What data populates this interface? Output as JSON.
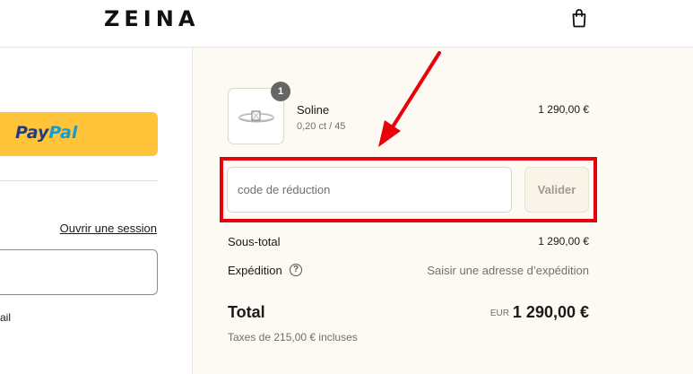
{
  "header": {
    "logo": "ZEINA",
    "cart_icon": "shopping-bag-icon"
  },
  "express_checkout": {
    "paypal_pay": "Pay",
    "paypal_pal": "Pal"
  },
  "contact": {
    "login_link": "Ouvrir une session",
    "email_value": "",
    "partial_label": "ail"
  },
  "order_summary": {
    "item": {
      "quantity": "1",
      "name": "Soline",
      "variant": "0,20 ct / 45",
      "price": "1 290,00 €",
      "image": "ring-icon"
    },
    "discount": {
      "placeholder": "code de réduction",
      "value": "",
      "apply_label": "Valider"
    },
    "subtotal_label": "Sous-total",
    "subtotal_value": "1 290,00 €",
    "shipping_label": "Expédition",
    "shipping_help_icon": "question-circle-icon",
    "shipping_value": "Saisir une adresse d’expédition",
    "total_label": "Total",
    "total_currency": "EUR",
    "total_value": "1 290,00 €",
    "tax_note": "Taxes de 215,00 € incluses"
  },
  "annotation": {
    "highlight_color": "#e8000b",
    "arrow_color": "#e8000b"
  },
  "colors": {
    "paypal_yellow": "#ffc439",
    "summary_background": "#fdf9f3"
  }
}
